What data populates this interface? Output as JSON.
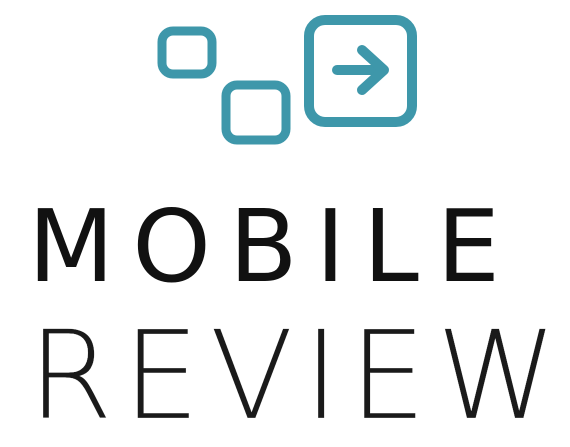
{
  "brand": {
    "line1": "MOBILE",
    "line2": "REVIEW",
    "accent_color": "#3e97aa",
    "text_color": "#111111"
  },
  "icons": {
    "arrow_square": "arrow-right-square-icon",
    "small_square_a": "square-outline-icon",
    "small_square_b": "square-outline-icon"
  }
}
